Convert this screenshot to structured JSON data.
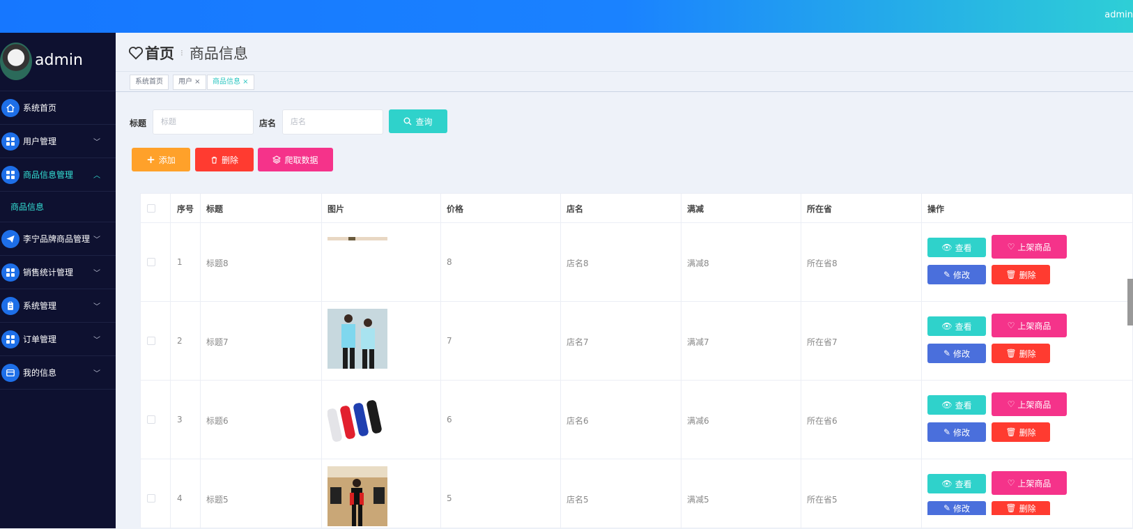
{
  "header": {
    "user_text": "admin"
  },
  "sidebar": {
    "username": "admin",
    "items": [
      {
        "label": "系统首页",
        "icon": "home-icon",
        "has_chevron": false
      },
      {
        "label": "用户管理",
        "icon": "grid-icon",
        "has_chevron": true
      },
      {
        "label": "商品信息管理",
        "icon": "grid-icon",
        "has_chevron": true,
        "active": true
      },
      {
        "label": "李宁品牌商品管理",
        "icon": "send-icon",
        "has_chevron": true
      },
      {
        "label": "销售统计管理",
        "icon": "grid-icon",
        "has_chevron": true
      },
      {
        "label": "系统管理",
        "icon": "clipboard-icon",
        "has_chevron": true
      },
      {
        "label": "订单管理",
        "icon": "grid-icon",
        "has_chevron": true
      },
      {
        "label": "我的信息",
        "icon": "card-icon",
        "has_chevron": true
      }
    ],
    "submenu_label": "商品信息"
  },
  "breadcrumb": {
    "home": "首页",
    "current": "商品信息"
  },
  "tabs": [
    "系统首页",
    "用户",
    "商品信息"
  ],
  "search": {
    "title_label": "标题",
    "title_placeholder": "标题",
    "shop_label": "店名",
    "shop_placeholder": "店名",
    "query_label": "查询"
  },
  "actions": {
    "add": "添加",
    "delete": "删除",
    "crawl": "爬取数据"
  },
  "table": {
    "columns": [
      "序号",
      "标题",
      "图片",
      "价格",
      "店名",
      "满减",
      "所在省",
      "操作"
    ],
    "rows": [
      {
        "index": "1",
        "title": "标题8",
        "price": "8",
        "shop": "店名8",
        "discount": "满减8",
        "province": "所在省8"
      },
      {
        "index": "2",
        "title": "标题7",
        "price": "7",
        "shop": "店名7",
        "discount": "满减7",
        "province": "所在省7"
      },
      {
        "index": "3",
        "title": "标题6",
        "price": "6",
        "shop": "店名6",
        "discount": "满减6",
        "province": "所在省6"
      },
      {
        "index": "4",
        "title": "标题5",
        "price": "5",
        "shop": "店名5",
        "discount": "满减5",
        "province": "所在省5"
      }
    ],
    "row_actions": {
      "view": "查看",
      "shelve": "上架商品",
      "edit": "修改",
      "delete": "删除"
    }
  },
  "colors": {
    "teal": "#2fd2cb",
    "pink": "#f5338a",
    "blue": "#4a6fdc",
    "red": "#ff3b30",
    "orange": "#ffa12a",
    "sidebar_bg": "#0e1130"
  }
}
